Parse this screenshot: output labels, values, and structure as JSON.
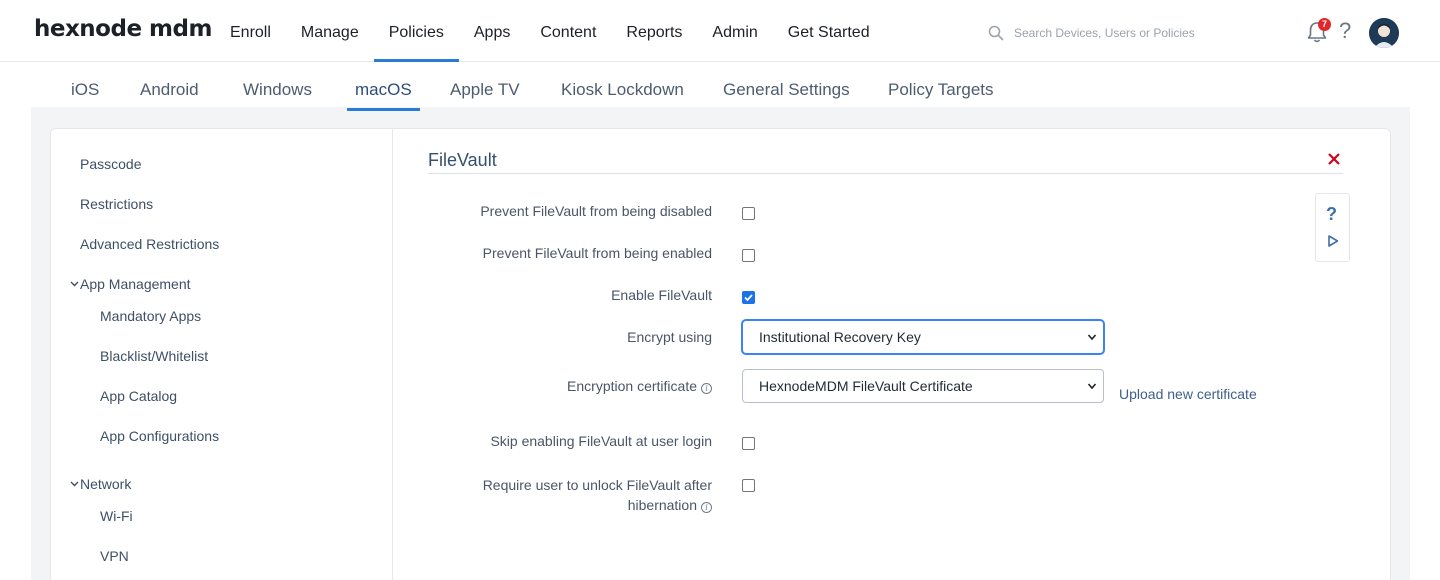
{
  "brand": {
    "logo_text": "hexnode mdm"
  },
  "main_nav": {
    "items": [
      "Enroll",
      "Manage",
      "Policies",
      "Apps",
      "Content",
      "Reports",
      "Admin",
      "Get Started"
    ],
    "active": "Policies"
  },
  "search": {
    "placeholder": "Search Devices, Users or Policies",
    "icon": "search-icon"
  },
  "notifications": {
    "count": "7",
    "icon": "bell-icon"
  },
  "help": {
    "icon": "question-icon",
    "label": "?"
  },
  "platform_tabs": {
    "items": [
      "iOS",
      "Android",
      "Windows",
      "macOS",
      "Apple TV",
      "Kiosk Lockdown",
      "General Settings",
      "Policy Targets"
    ],
    "active": "macOS"
  },
  "sidebar": {
    "items": {
      "passcode": "Passcode",
      "restrictions": "Restrictions",
      "advanced_restrictions": "Advanced Restrictions",
      "app_management": "App Management",
      "mandatory_apps": "Mandatory Apps",
      "blacklist_whitelist": "Blacklist/Whitelist",
      "app_catalog": "App Catalog",
      "app_configurations": "App Configurations",
      "network": "Network",
      "wifi": "Wi-Fi",
      "vpn": "VPN"
    }
  },
  "section": {
    "title": "FileVault",
    "close_icon": "close-icon",
    "fields": {
      "prevent_disable": {
        "label": "Prevent FileVault from being disabled",
        "checked": false
      },
      "prevent_enable": {
        "label": "Prevent FileVault from being enabled",
        "checked": false
      },
      "enable_filevault": {
        "label": "Enable FileVault",
        "checked": true
      },
      "encrypt_using": {
        "label": "Encrypt using",
        "value": "Institutional Recovery Key"
      },
      "encryption_certificate": {
        "label": "Encryption certificate",
        "value": "HexnodeMDM FileVault Certificate",
        "link": "Upload new certificate"
      },
      "skip_at_login": {
        "label": "Skip enabling FileVault at user login",
        "checked": false
      },
      "require_unlock_line1": "Require user to unlock FileVault after",
      "require_unlock_line2": "hibernation",
      "require_unlock_checked": false
    }
  },
  "colors": {
    "accent": "#2a7bd8",
    "checked": "#1a73e8",
    "close": "#d0021b",
    "badge": "#e2262b"
  }
}
